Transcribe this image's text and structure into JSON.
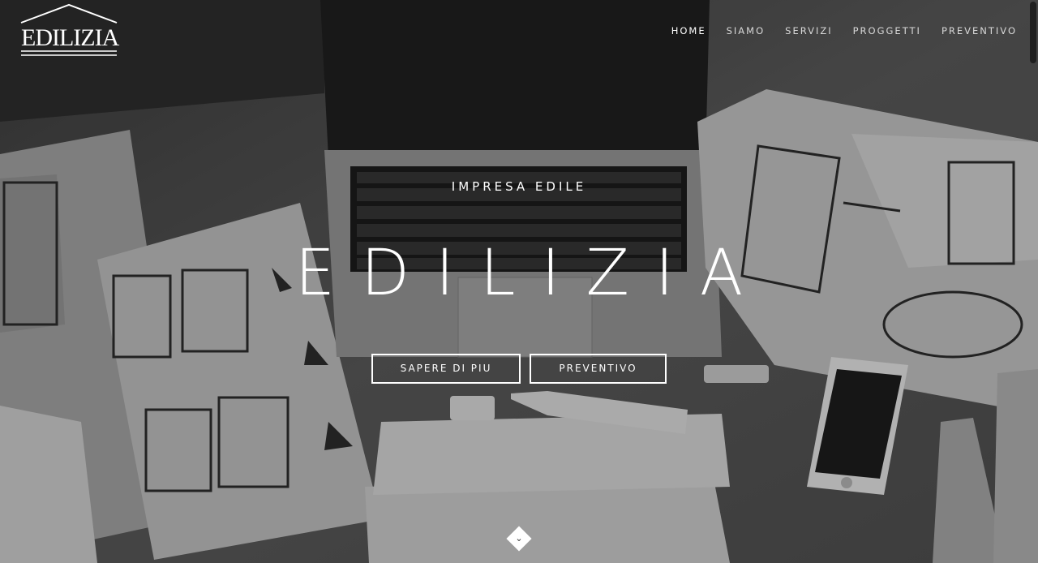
{
  "brand": {
    "logo_text": "EDILIZIA"
  },
  "nav": {
    "items": [
      {
        "label": "HOME",
        "active": true
      },
      {
        "label": "SIAMO",
        "active": false
      },
      {
        "label": "SERVIZI",
        "active": false
      },
      {
        "label": "PROGGETTI",
        "active": false
      },
      {
        "label": "PREVENTIVO",
        "active": false
      }
    ]
  },
  "hero": {
    "subtitle": "IMPRESA EDILE",
    "title": "EDILIZIA",
    "primary_button": "SAPERE DI PIU",
    "secondary_button": "PREVENTIVO",
    "scroll_icon": "chevron-down-icon"
  },
  "colors": {
    "text": "#ffffff",
    "nav_text": "#d8d8d8"
  }
}
